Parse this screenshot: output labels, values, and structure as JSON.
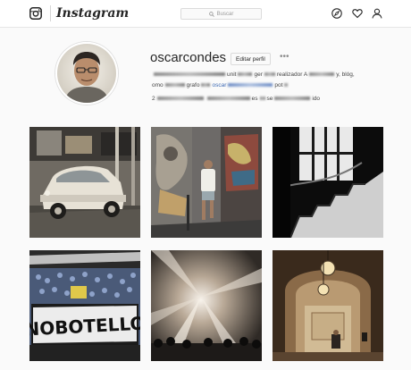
{
  "header": {
    "brand": "Instagram",
    "search": {
      "placeholder": "Buscar",
      "icon": "search-icon"
    },
    "nav_icons": [
      "compass-icon",
      "heart-icon",
      "profile-icon"
    ]
  },
  "profile": {
    "username": "oscarcondes",
    "edit_button": "Editar perfil",
    "more": "•••",
    "bio_lines": [
      [
        "unit",
        "ger",
        "realizador A",
        "y, blóg,"
      ],
      [
        "omo",
        "grafo",
        "oscar",
        "pot"
      ],
      [
        "2",
        "es",
        "se",
        "ido"
      ]
    ]
  },
  "posts": [
    {
      "alt": "vintage white car in a garage"
    },
    {
      "alt": "man walking past graffiti street"
    },
    {
      "alt": "black and white staircase with window"
    },
    {
      "alt": "crowd with NO BOTELLON banner"
    },
    {
      "alt": "concert stage with light beams"
    },
    {
      "alt": "person sitting under ornate archway lamps"
    }
  ],
  "colors": {
    "border": "#dbdbdb",
    "text": "#262626",
    "background": "#fafafa"
  }
}
